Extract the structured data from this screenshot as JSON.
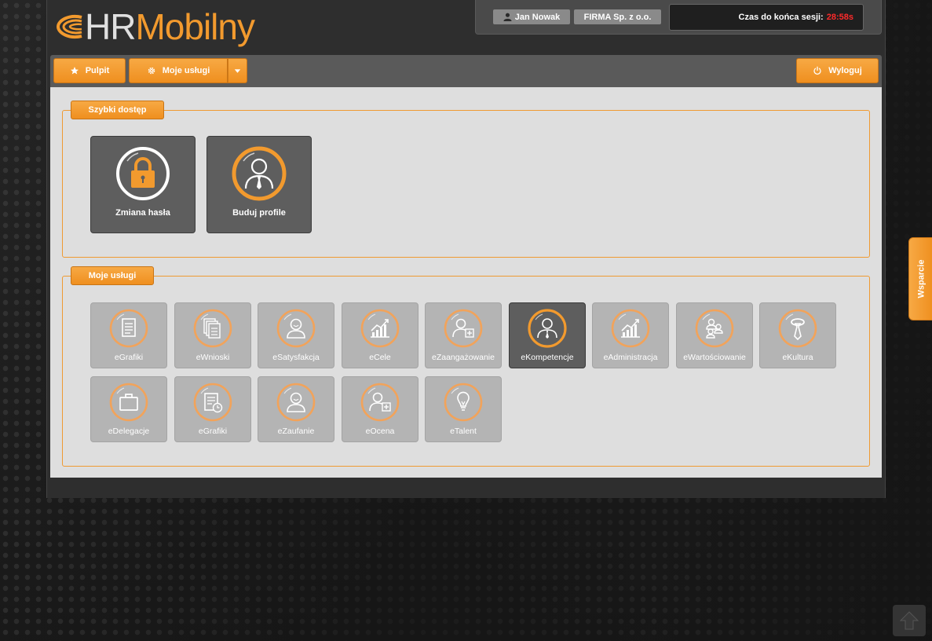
{
  "app": {
    "logo_hr": "HR",
    "logo_rest": "Mobilny"
  },
  "header": {
    "user_name": "Jan Nowak",
    "company": "FIRMA Sp. z o.o.",
    "session_label": "Czas do końca sesji:",
    "session_time": "28:58s"
  },
  "nav": {
    "pulpit_label": "Pulpit",
    "moje_uslugi_label": "Moje usługi",
    "wyloguj_label": "Wyloguj"
  },
  "quick_access": {
    "title": "Szybki dostęp",
    "items": [
      {
        "label": "Zmiana hasła",
        "icon": "lock-icon"
      },
      {
        "label": "Buduj profile",
        "icon": "user-tie-icon"
      }
    ]
  },
  "services": {
    "title": "Moje usługi",
    "items": [
      {
        "label": "eGrafiki",
        "icon": "document-icon"
      },
      {
        "label": "eWnioski",
        "icon": "documents-stack-icon"
      },
      {
        "label": "eSatysfakcja",
        "icon": "smiling-person-icon"
      },
      {
        "label": "eCele",
        "icon": "growth-chart-icon"
      },
      {
        "label": "eZaangażowanie",
        "icon": "person-plus-icon"
      },
      {
        "label": "eKompetencje",
        "icon": "user-tie-icon",
        "active": true
      },
      {
        "label": "eAdministracja",
        "icon": "growth-chart-icon"
      },
      {
        "label": "eWartościowanie",
        "icon": "people-group-icon"
      },
      {
        "label": "eKultura",
        "icon": "tie-icon"
      },
      {
        "label": "eDelegacje",
        "icon": "briefcase-icon"
      },
      {
        "label": "eGrafiki",
        "icon": "document-clock-icon"
      },
      {
        "label": "eZaufanie",
        "icon": "smiling-person-icon"
      },
      {
        "label": "eOcena",
        "icon": "person-plus-icon"
      },
      {
        "label": "eTalent",
        "icon": "lightbulb-icon"
      }
    ]
  },
  "sidebar": {
    "support_label": "Wsparcie"
  },
  "colors": {
    "accent": "#ef8f1f",
    "session_time": "#ff2a2a",
    "tile_inactive": "#b4b4b4",
    "tile_active": "#5e5e5e"
  }
}
